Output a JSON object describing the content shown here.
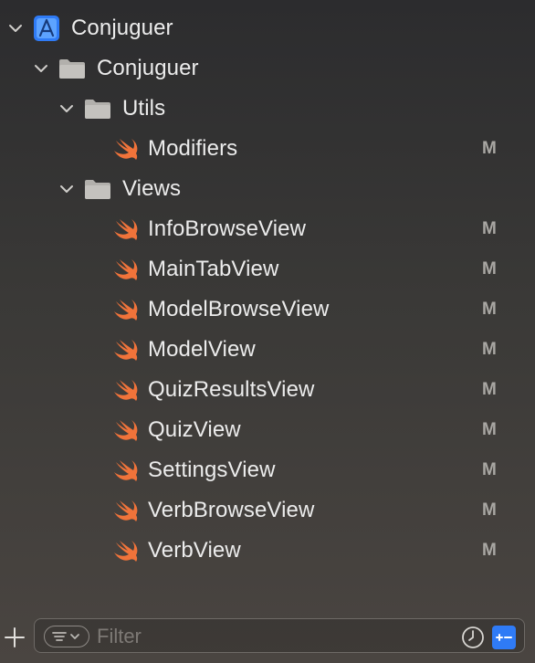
{
  "project": {
    "name": "Conjuguer",
    "root_group": {
      "name": "Conjuguer",
      "groups": [
        {
          "name": "Utils",
          "files": [
            {
              "name": "Modifiers",
              "status": "M"
            }
          ]
        },
        {
          "name": "Views",
          "files": [
            {
              "name": "InfoBrowseView",
              "status": "M"
            },
            {
              "name": "MainTabView",
              "status": "M"
            },
            {
              "name": "ModelBrowseView",
              "status": "M"
            },
            {
              "name": "ModelView",
              "status": "M"
            },
            {
              "name": "QuizResultsView",
              "status": "M"
            },
            {
              "name": "QuizView",
              "status": "M"
            },
            {
              "name": "SettingsView",
              "status": "M"
            },
            {
              "name": "VerbBrowseView",
              "status": "M"
            },
            {
              "name": "VerbView",
              "status": "M"
            }
          ]
        }
      ]
    }
  },
  "filter": {
    "placeholder": "Filter"
  },
  "icons": {
    "disclosure": "chevron-down-icon",
    "project": "xcode-project-icon",
    "group": "folder-icon",
    "file": "swift-file-icon",
    "add": "plus-icon",
    "filter_menu": "filter-options-icon",
    "recent": "clock-icon",
    "scm": "source-control-filter-icon"
  },
  "colors": {
    "swift_orange": "#f0733a",
    "project_blue": "#2f7bf6",
    "folder_gray": "#b2b0ac",
    "badge_gray": "#a9a7a3"
  }
}
